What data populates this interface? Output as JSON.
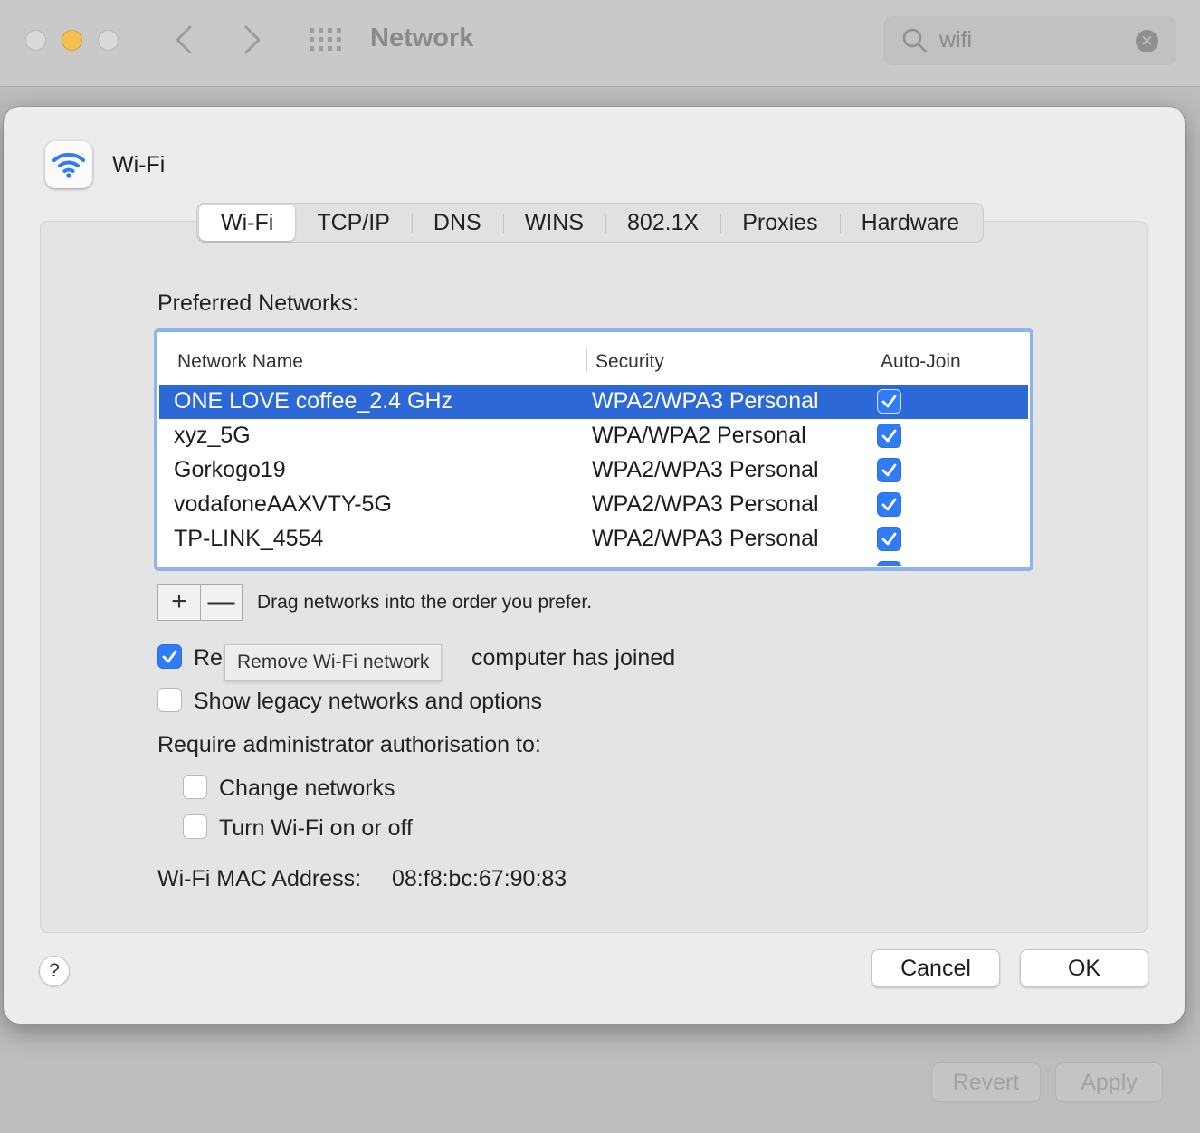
{
  "window": {
    "title": "Network",
    "search_value": "wifi"
  },
  "background_buttons": {
    "revert": "Revert",
    "apply": "Apply"
  },
  "sheet": {
    "title": "Wi-Fi",
    "tabs": [
      "Wi-Fi",
      "TCP/IP",
      "DNS",
      "WINS",
      "802.1X",
      "Proxies",
      "Hardware"
    ],
    "active_tab": "Wi-Fi",
    "preferred_label": "Preferred Networks:",
    "table": {
      "columns": [
        "Network Name",
        "Security",
        "Auto-Join"
      ],
      "rows": [
        {
          "name": "ONE LOVE coffee_2.4 GHz",
          "security": "WPA2/WPA3 Personal",
          "auto_join": true,
          "selected": true
        },
        {
          "name": "xyz_5G",
          "security": "WPA/WPA2 Personal",
          "auto_join": true,
          "selected": false
        },
        {
          "name": "Gorkogo19",
          "security": "WPA2/WPA3 Personal",
          "auto_join": true,
          "selected": false
        },
        {
          "name": "vodafoneAAXVTY-5G",
          "security": "WPA2/WPA3 Personal",
          "auto_join": true,
          "selected": false
        },
        {
          "name": "TP-LINK_4554",
          "security": "WPA2/WPA3 Personal",
          "auto_join": true,
          "selected": false
        }
      ]
    },
    "add_label": "+",
    "remove_label": "—",
    "drag_hint": "Drag networks into the order you prefer.",
    "remember_prefix": "Re",
    "remember_suffix": "computer has joined",
    "tooltip": "Remove Wi-Fi network",
    "legacy_label": "Show legacy networks and options",
    "admin_label": "Require administrator authorisation to:",
    "change_networks_label": "Change networks",
    "turn_wifi_label": "Turn Wi-Fi on or off",
    "mac_label": "Wi-Fi MAC Address:",
    "mac_value": "08:f8:bc:67:90:83",
    "help_label": "?",
    "cancel_label": "Cancel",
    "ok_label": "OK",
    "checkbox_states": {
      "remember": true,
      "legacy": false,
      "change_networks": false,
      "turn_wifi": false
    }
  },
  "colors": {
    "accent": "#2f7cf6",
    "selection": "#2c69d6",
    "focus_ring": "#8eb4ef"
  }
}
